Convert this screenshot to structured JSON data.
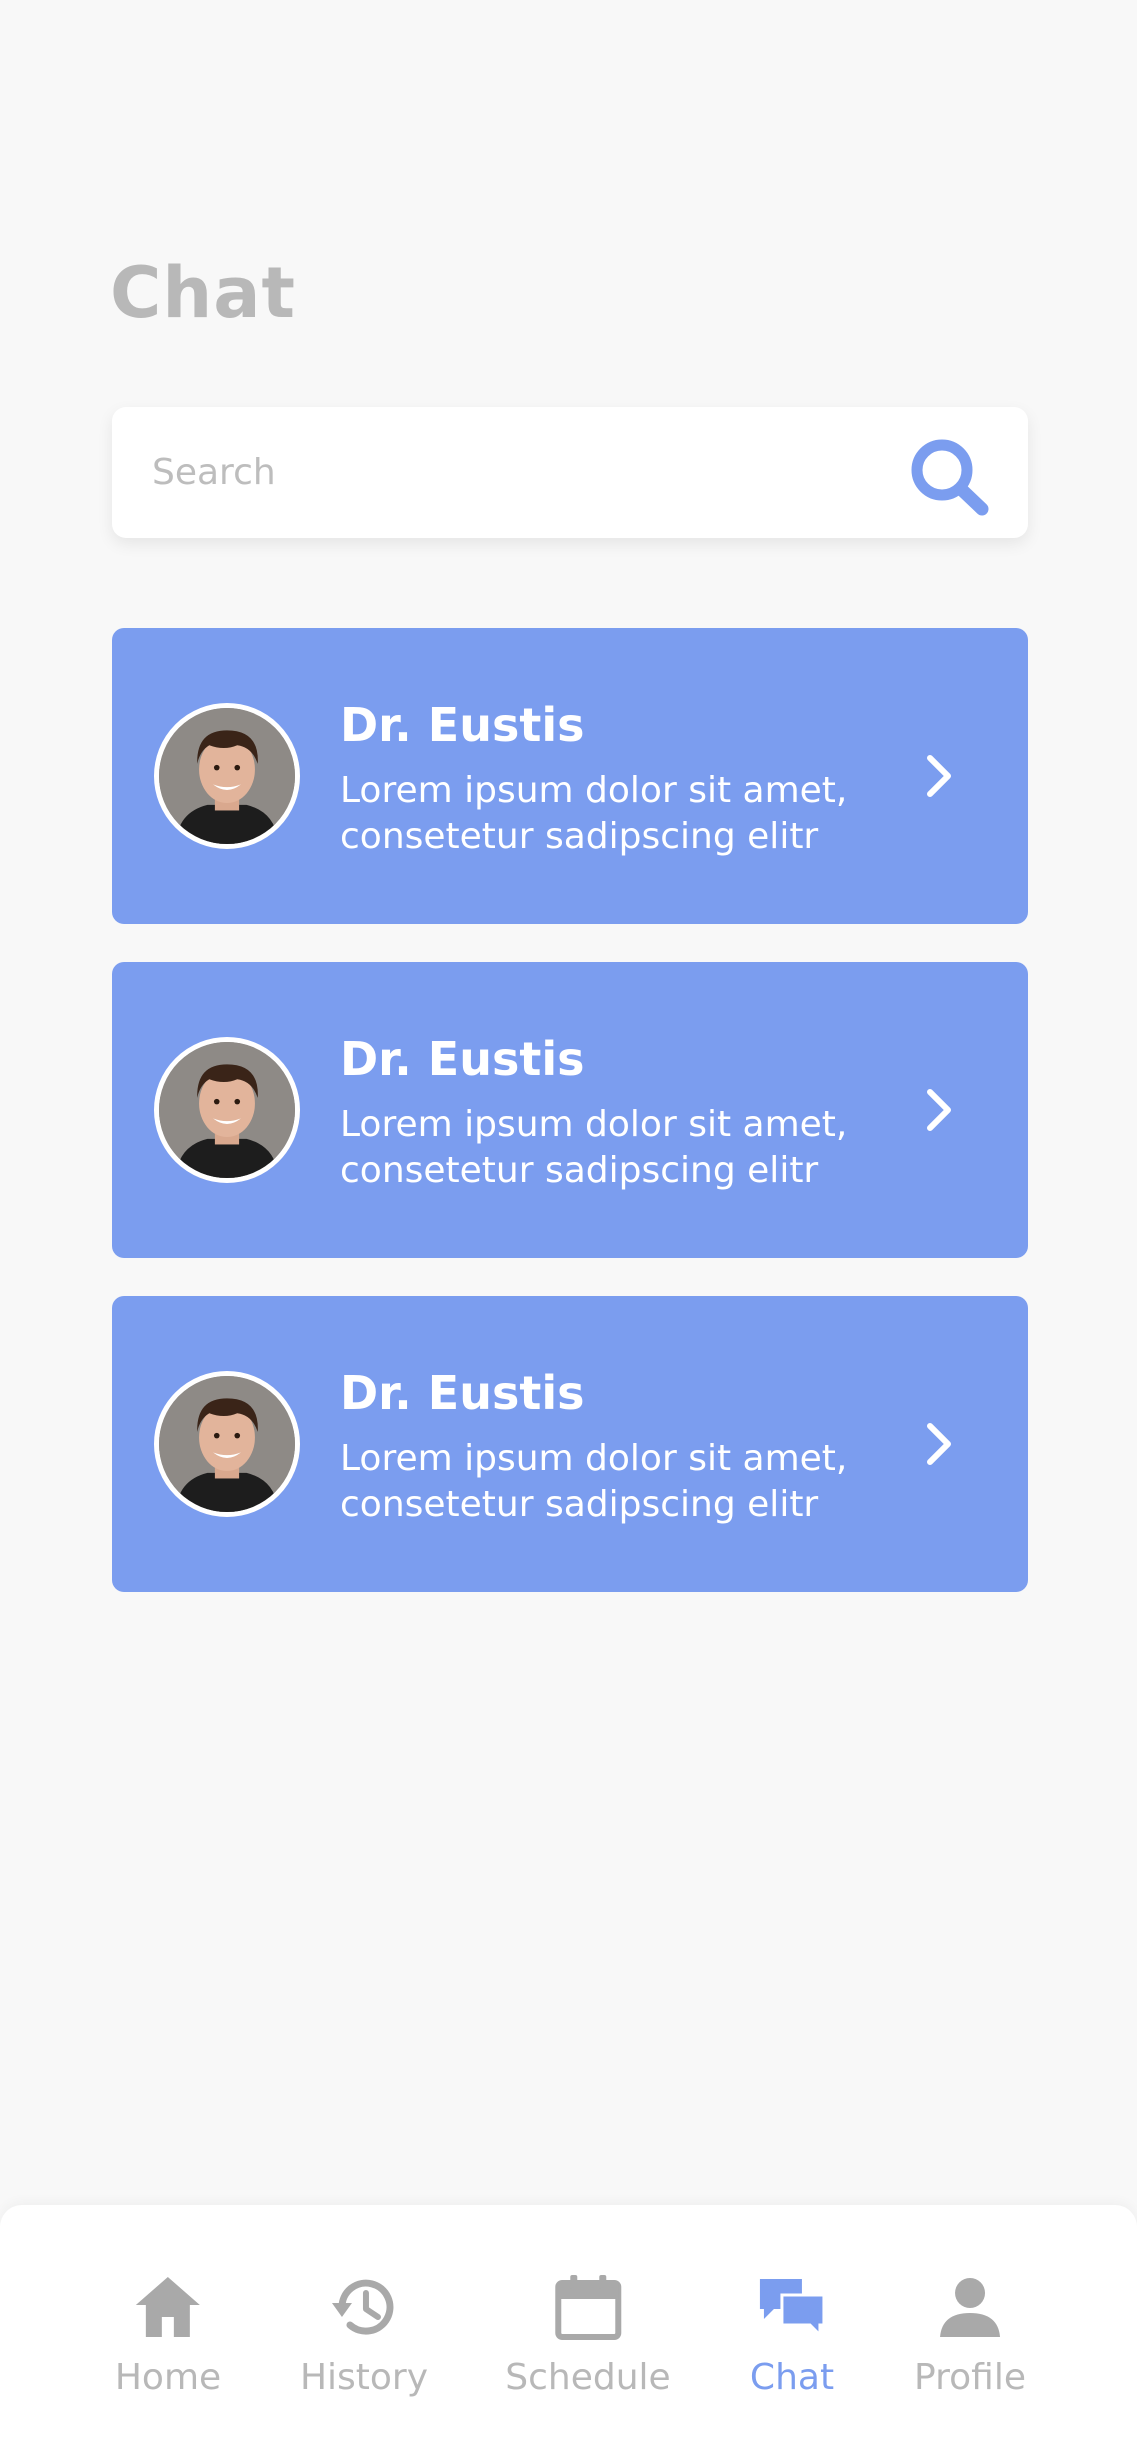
{
  "header": {
    "title": "Chat"
  },
  "search": {
    "placeholder": "Search",
    "value": "",
    "icon": "search-icon"
  },
  "chats": [
    {
      "name": "Dr. Eustis",
      "preview": "Lorem ipsum dolor sit amet, consetetur sadipscing elitr"
    },
    {
      "name": "Dr. Eustis",
      "preview": "Lorem ipsum dolor sit amet, consetetur sadipscing elitr"
    },
    {
      "name": "Dr. Eustis",
      "preview": "Lorem ipsum dolor sit amet, consetetur sadipscing elitr"
    }
  ],
  "nav": {
    "active": "Chat",
    "items": [
      {
        "label": "Home",
        "icon": "home-icon"
      },
      {
        "label": "History",
        "icon": "history-icon"
      },
      {
        "label": "Schedule",
        "icon": "calendar-icon"
      },
      {
        "label": "Chat",
        "icon": "chat-icon"
      },
      {
        "label": "Profile",
        "icon": "profile-icon"
      }
    ]
  },
  "colors": {
    "accent": "#7b9def",
    "background": "#f8f8f8",
    "muted_text": "#b8b8b8",
    "card_text": "#ffffff"
  }
}
